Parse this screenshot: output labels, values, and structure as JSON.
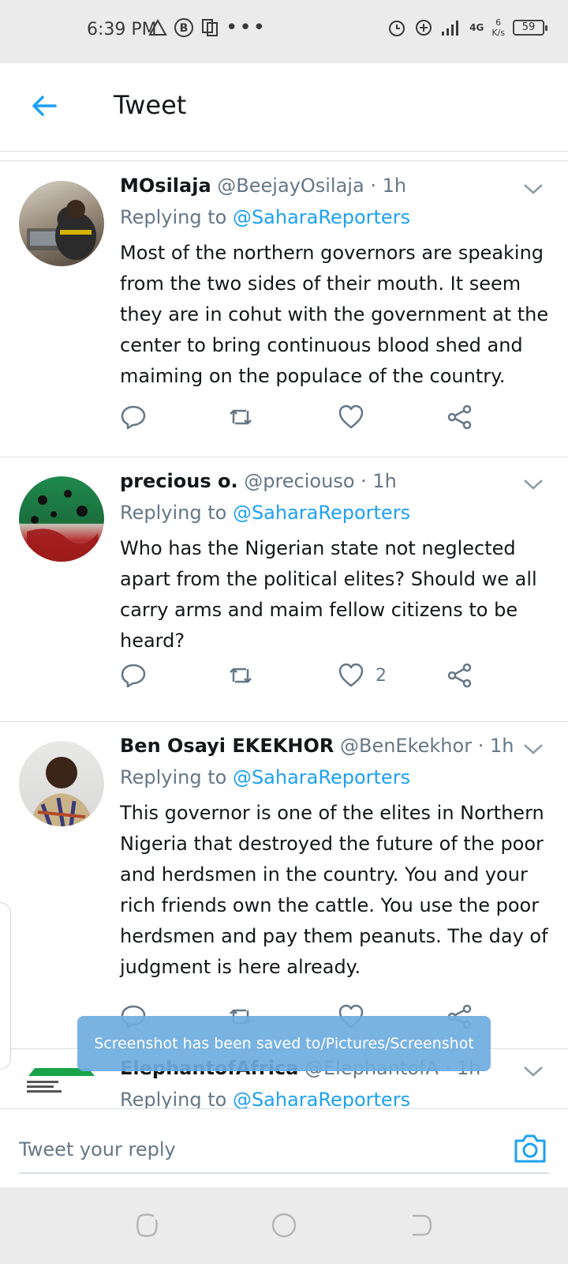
{
  "status_bar": {
    "time": "6:39 PM",
    "netspeed_value": "6",
    "netspeed_unit": "K/s",
    "network_label": "4G",
    "battery": "59",
    "icons": [
      "warning-triangle-icon",
      "b-circle-icon",
      "sync-icon",
      "more-dots-icon",
      "alarm-icon",
      "add-circle-icon",
      "signal-icon",
      "battery-icon"
    ]
  },
  "header": {
    "title": "Tweet",
    "back_icon": "arrow-left-icon"
  },
  "tweets": [
    {
      "name": "MOsilaja",
      "handle": "@BeejayOsilaja",
      "time": "· 1h",
      "replying_prefix": "Replying to ",
      "replying_to": "@SaharaReporters",
      "text": "Most of the northern governors are speaking from the two sides of their mouth. It seem they are in cohut with the government at the center to bring continuous blood shed and maiming on the populace of the country.",
      "like_count": ""
    },
    {
      "name": "precious o.",
      "handle": "@preciouso",
      "time": "· 1h",
      "replying_prefix": "Replying to ",
      "replying_to": "@SaharaReporters",
      "text": "Who has the Nigerian state not neglected apart from the political elites? Should we all carry arms and maim fellow citizens to be heard?",
      "like_count": "2"
    },
    {
      "name": "Ben Osayi EKEKHOR",
      "handle": "@BenEkekhor",
      "time": "· 1h",
      "replying_prefix": "Replying to ",
      "replying_to": "@SaharaReporters",
      "text": "This governor is one of the elites in Northern Nigeria that destroyed the future of the poor and herdsmen in the country. You and your rich friends own the cattle. You use the poor herdsmen and pay them peanuts. The day of judgment is here already.",
      "like_count": ""
    },
    {
      "name": "ElephantofAfrica",
      "handle": "@ElephantofA",
      "time": "· 1h",
      "replying_prefix": "Replying to ",
      "replying_to": "@SaharaReporters"
    }
  ],
  "toast": {
    "message": "Screenshot has been saved to/Pictures/Screenshot"
  },
  "reply_bar": {
    "placeholder": "Tweet your reply"
  },
  "colors": {
    "accent": "#1da1f2",
    "secondary_text": "#657786",
    "divider": "#d9dee2",
    "system_bar": "#ebebeb"
  }
}
